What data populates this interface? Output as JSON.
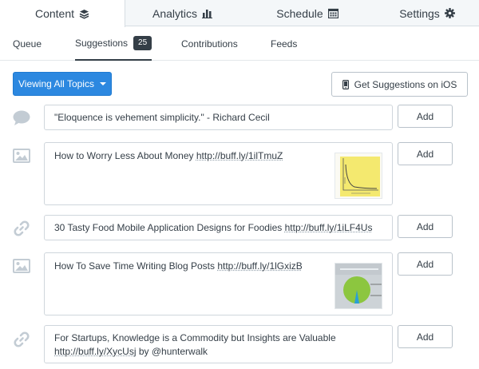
{
  "top_tabs": [
    {
      "label": "Content",
      "icon": "layers-icon"
    },
    {
      "label": "Analytics",
      "icon": "bar-chart-icon"
    },
    {
      "label": "Schedule",
      "icon": "calendar-icon"
    },
    {
      "label": "Settings",
      "icon": "gear-icon"
    }
  ],
  "sub_tabs": [
    {
      "label": "Queue"
    },
    {
      "label": "Suggestions",
      "badge": "25"
    },
    {
      "label": "Contributions"
    },
    {
      "label": "Feeds"
    }
  ],
  "actions": {
    "topics_label": "Viewing All Topics",
    "ios_label": "Get Suggestions on iOS"
  },
  "colors": {
    "accent_blue": "#2c88e0",
    "text_dark": "#343e47",
    "icon_gray": "#c3ccd4"
  },
  "suggestions": [
    {
      "type": "quote-icon",
      "text": "\"Eloquence is vehement simplicity.\" - Richard Cecil",
      "add_label": "Add"
    },
    {
      "type": "image-icon",
      "text_before": "How to Worry Less About Money ",
      "link": "http://buff.ly/1ilTmuZ",
      "add_label": "Add"
    },
    {
      "type": "link-icon",
      "text_before": "30 Tasty Food Mobile Application Designs for Foodies ",
      "link": "http://buff.ly/1iLF4Us",
      "add_label": "Add"
    },
    {
      "type": "image-icon",
      "text_before": "How To Save Time Writing Blog Posts ",
      "link": "http://buff.ly/1lGxizB",
      "add_label": "Add"
    },
    {
      "type": "link-icon",
      "text_before": "For Startups, Knowledge is a Commodity but Insights are Valuable ",
      "link": "http://buff.ly/XycUsj",
      "text_after": " by @hunterwalk",
      "add_label": "Add"
    }
  ]
}
